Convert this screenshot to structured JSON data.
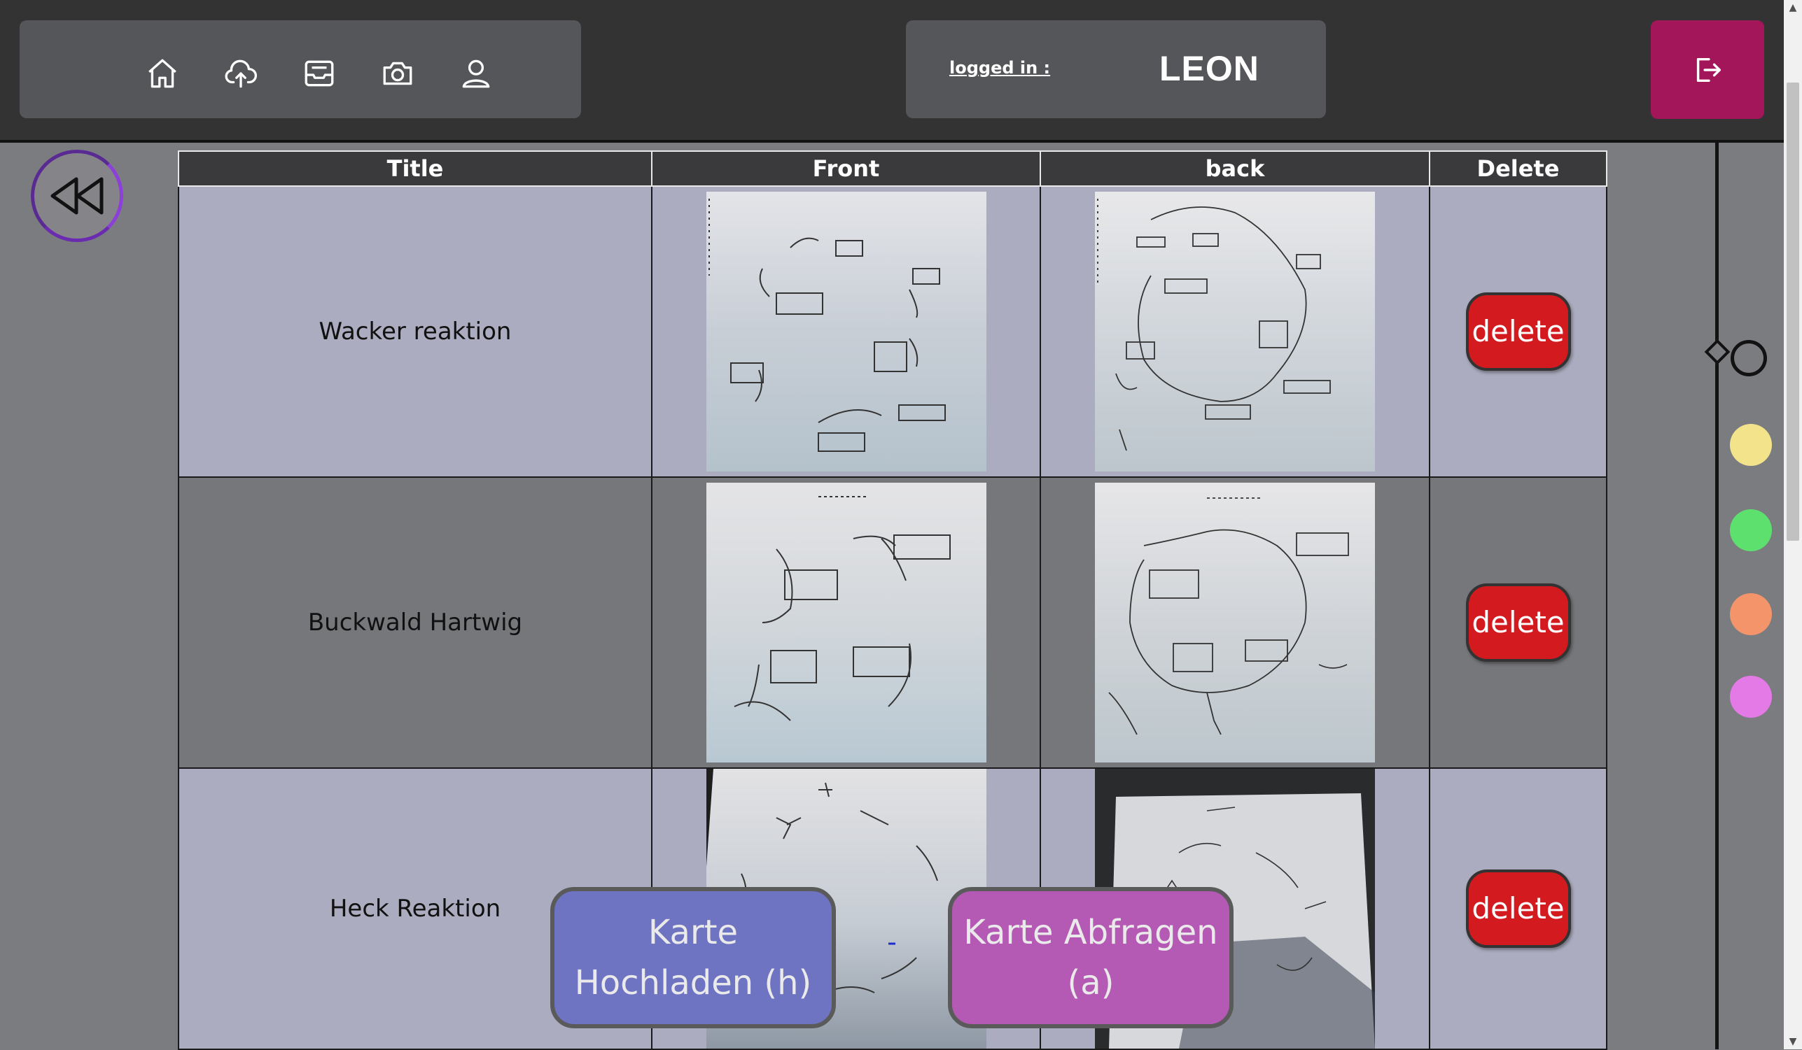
{
  "nav": {
    "icons": [
      {
        "name": "home-icon"
      },
      {
        "name": "cloud-upload-icon"
      },
      {
        "name": "inbox-icon"
      },
      {
        "name": "camera-icon"
      },
      {
        "name": "user-icon"
      }
    ]
  },
  "login": {
    "label": "logged in :",
    "user": "LEON"
  },
  "logout": {
    "icon": "logout-icon"
  },
  "back": {
    "icon": "rewind-icon"
  },
  "table": {
    "headers": [
      "Title",
      "Front",
      "back",
      "Delete"
    ],
    "rows": [
      {
        "title": "Wacker reaktion",
        "delete_label": "delete"
      },
      {
        "title": "Buckwald Hartwig",
        "delete_label": "delete"
      },
      {
        "title": "Heck Reaktion",
        "delete_label": "delete"
      }
    ]
  },
  "colors": {
    "yellow": "#f3e48c",
    "green": "#5ee06f",
    "orange": "#f3946a",
    "pink": "#e47ae6",
    "accent_logout": "#a3175a",
    "delete_red": "#d21a1f"
  },
  "actions": {
    "upload_label_line1": "Karte",
    "upload_label_line2": "Hochladen (h)",
    "query_label_line1": "Karte Abfragen",
    "query_label_line2": "(a)"
  }
}
